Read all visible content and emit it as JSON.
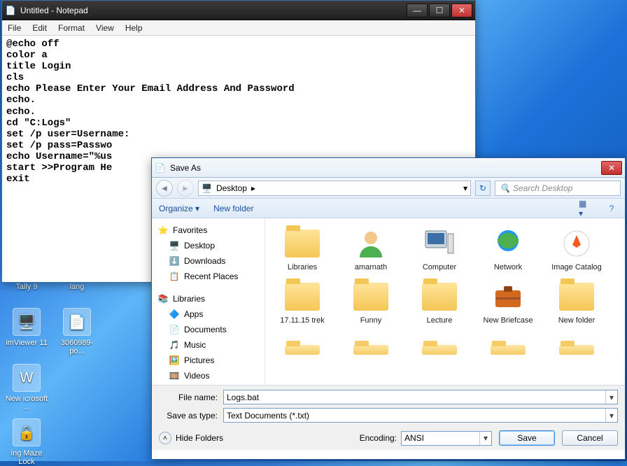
{
  "desktop": {
    "icons": [
      {
        "label": "Tally 9"
      },
      {
        "label": "lang"
      },
      {
        "label": "imViewer 11"
      },
      {
        "label": "3060989-po..."
      },
      {
        "label": "New icrosoft ..."
      },
      {
        "label": "ing Maze Lock"
      }
    ]
  },
  "notepad": {
    "title": "Untitled - Notepad",
    "menu": [
      "File",
      "Edit",
      "Format",
      "View",
      "Help"
    ],
    "content": "@echo off\ncolor a\ntitle Login\ncls\necho Please Enter Your Email Address And Password\necho.\necho.\ncd \"C:Logs\"\nset /p user=Username:\nset /p pass=Passwo\necho Username=\"%us\nstart >>Program He\nexit"
  },
  "saveas": {
    "title": "Save As",
    "breadcrumb_icon": "desktop",
    "breadcrumb": "Desktop",
    "breadcrumb_arrow": "▸",
    "search_placeholder": "Search Desktop",
    "toolbar": {
      "organize": "Organize",
      "organize_arrow": "▾",
      "newfolder": "New folder"
    },
    "nav": {
      "favorites": {
        "label": "Favorites",
        "items": [
          "Desktop",
          "Downloads",
          "Recent Places"
        ]
      },
      "libraries": {
        "label": "Libraries",
        "items": [
          "Apps",
          "Documents",
          "Music",
          "Pictures",
          "Videos"
        ]
      }
    },
    "files": [
      {
        "label": "Libraries",
        "kind": "libraries"
      },
      {
        "label": "amarnath",
        "kind": "user"
      },
      {
        "label": "Computer",
        "kind": "computer"
      },
      {
        "label": "Network",
        "kind": "network"
      },
      {
        "label": "Image Catalog",
        "kind": "app"
      },
      {
        "label": "17.11.15 trek",
        "kind": "folder"
      },
      {
        "label": "Funny",
        "kind": "folder"
      },
      {
        "label": "Lecture",
        "kind": "folder"
      },
      {
        "label": "New Briefcase",
        "kind": "briefcase"
      },
      {
        "label": "New folder",
        "kind": "folder"
      }
    ],
    "filename_label": "File name:",
    "filename_value": "Logs.bat",
    "type_label": "Save as type:",
    "type_value": "Text Documents (*.txt)",
    "hide_folders": "Hide Folders",
    "encoding_label": "Encoding:",
    "encoding_value": "ANSI",
    "save": "Save",
    "cancel": "Cancel"
  }
}
